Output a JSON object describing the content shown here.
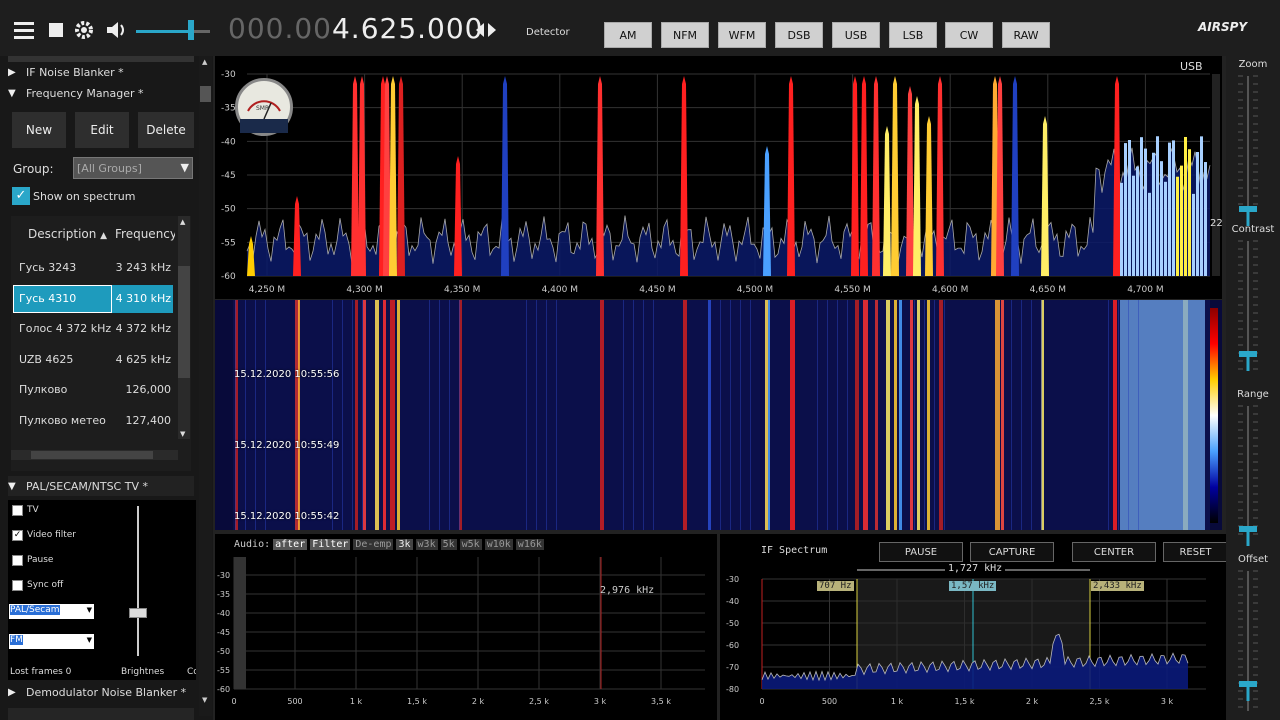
{
  "toolbar": {
    "menu_icon": "hamburger-icon",
    "stop_icon": "stop-icon",
    "settings_icon": "gear-icon",
    "volume_icon": "speaker-icon",
    "frequency_dim": "000.00",
    "frequency_bright": "4.625.000",
    "tune_arrows_icon": "left-right-arrows-icon",
    "detector_label": "Detector",
    "modes": [
      "AM",
      "NFM",
      "WFM",
      "DSB",
      "USB",
      "LSB",
      "CW",
      "RAW"
    ],
    "brand": "AIRSPY"
  },
  "left": {
    "sections": {
      "if_noise_blanker": "IF Noise Blanker *",
      "frequency_manager": "Frequency Manager *",
      "pal_secam": "PAL/SECAM/NTSC TV *",
      "demod_noise_blanker": "Demodulator Noise Blanker *"
    },
    "buttons": {
      "new": "New",
      "edit": "Edit",
      "delete": "Delete"
    },
    "group_label": "Group:",
    "group_value": "[All Groups]",
    "show_on_spectrum": "Show on spectrum",
    "columns": {
      "description": "Description",
      "frequency": "Frequency"
    },
    "rows": [
      {
        "desc": "Гусь 3243",
        "freq": "3 243 kHz",
        "selected": false
      },
      {
        "desc": "Гусь 4310",
        "freq": "4 310 kHz",
        "selected": true
      },
      {
        "desc": "Голос 4 372 kHz",
        "freq": "4 372 kHz",
        "selected": false
      },
      {
        "desc": "UZB 4625",
        "freq": "4 625 kHz",
        "selected": false
      },
      {
        "desc": "Пулково",
        "freq": "126,000",
        "selected": false
      },
      {
        "desc": "Пулково метео",
        "freq": "127,400",
        "selected": false
      }
    ],
    "tv": {
      "tv": "TV",
      "video_filter": "Video filter",
      "pause": "Pause",
      "sync_off": "Sync off",
      "standard": "PAL/Secam",
      "mode": "FM",
      "lost_frames": "Lost frames 0",
      "brightness": "Brightnes",
      "contrast_abbr": "Co"
    }
  },
  "spectrum": {
    "mode_label": "USB",
    "y_ticks": [
      "-30",
      "-35",
      "-40",
      "-45",
      "-50",
      "-55",
      "-60"
    ],
    "x_ticks": [
      "4,250 M",
      "4,300 M",
      "4,350 M",
      "4,400 M",
      "4,450 M",
      "4,500 M",
      "4,550 M",
      "4,600 M",
      "4,650 M",
      "4,700 M"
    ],
    "right_value": "22",
    "meter_label": "SMR"
  },
  "waterfall": {
    "timestamps": [
      "15.12.2020 10:55:56",
      "15.12.2020 10:55:49",
      "15.12.2020 10:55:42"
    ]
  },
  "audio": {
    "label": "Audio:",
    "tags": [
      "after",
      "Filter",
      "De-emp",
      "3k",
      "w3k",
      "5k",
      "w5k",
      "w10k",
      "w16k"
    ],
    "marker": "2,976 kHz",
    "y_ticks": [
      "-30",
      "-35",
      "-40",
      "-45",
      "-50",
      "-55",
      "-60"
    ],
    "x_ticks": [
      "0",
      "500",
      "1 k",
      "1,5 k",
      "2 k",
      "2,5 k",
      "3 k",
      "3,5 k"
    ]
  },
  "ifspectrum": {
    "title": "IF Spectrum",
    "buttons": [
      "PAUSE",
      "CAPTURE",
      "CENTER",
      "RESET"
    ],
    "bandwidth": "1,727 kHz",
    "markers": [
      "707 Hz",
      "1,57 kHz",
      "2,433 kHz"
    ],
    "y_ticks": [
      "-30",
      "-40",
      "-50",
      "-60",
      "-70",
      "-80"
    ],
    "x_ticks": [
      "0",
      "500",
      "1 k",
      "1,5 k",
      "2 k",
      "2,5 k",
      "3 k"
    ]
  },
  "right": {
    "zoom": "Zoom",
    "contrast": "Contrast",
    "range": "Range",
    "offset": "Offset"
  }
}
